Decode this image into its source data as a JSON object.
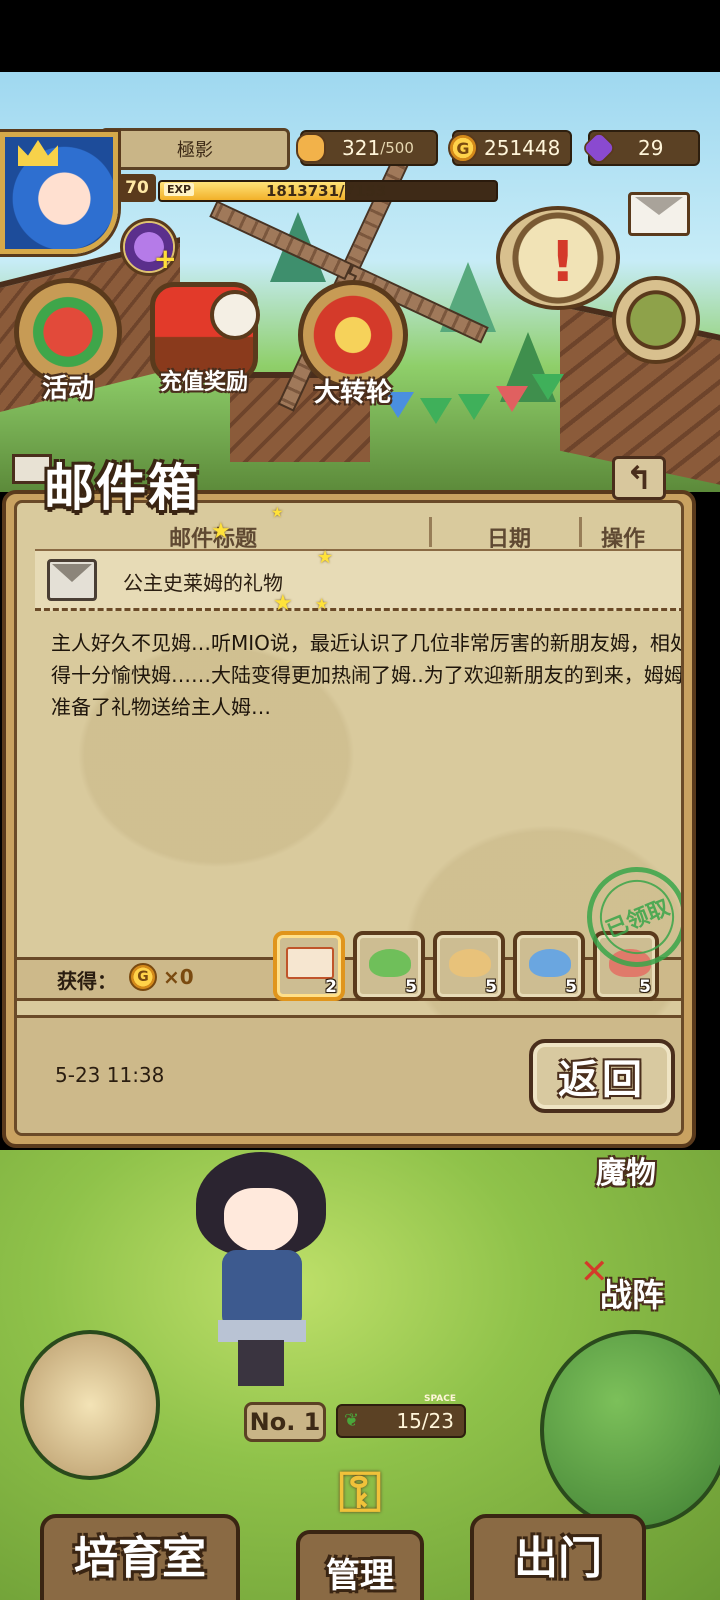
{
  "header": {
    "player_name": "極影",
    "level": "70",
    "exp_label": "EXP",
    "exp_value": "1813731/7153",
    "exp_fill_fraction": 0.55
  },
  "resources": {
    "bread": {
      "value": "321",
      "max": "/500",
      "icon": "bread-icon"
    },
    "gold": {
      "value": "251448",
      "icon": "gold-coin-icon",
      "symbol": "G"
    },
    "gem": {
      "value": "29",
      "icon": "purple-gem-icon"
    }
  },
  "top_buttons": {
    "activity": "活动",
    "recharge_reward": "充值奖励",
    "big_wheel": "大转轮",
    "scroll_alert": "!"
  },
  "mailbox": {
    "title": "邮件箱",
    "columns": [
      "邮件标题",
      "日期",
      "操作"
    ],
    "subject": "公主史莱姆的礼物",
    "body": "主人好久不见姆…听MIO说，最近认识了几位非常厉害的新朋友姆，相处得十分愉快姆……大陆变得更加热闹了姆..为了欢迎新朋友的到来，姆姆准备了礼物送给主人姆…",
    "got_label": "获得：",
    "gold_symbol": "G",
    "gold_amount": "×0",
    "items": [
      {
        "icon": "ticket-icon",
        "qty": "2",
        "color": "#f6e6d0"
      },
      {
        "icon": "green-slime-icon",
        "qty": "5",
        "color": "#6fbf5a"
      },
      {
        "icon": "yellow-slime-icon",
        "qty": "5",
        "color": "#e8c27a"
      },
      {
        "icon": "blue-slime-icon",
        "qty": "5",
        "color": "#6aa6e0"
      },
      {
        "icon": "red-slime-icon",
        "qty": "5",
        "color": "#e07a6a"
      }
    ],
    "claimed_stamp": "已领取",
    "date": "5-23 11:38",
    "return_label": "返回"
  },
  "scene": {
    "monster_label": "魔物",
    "formation_label": "战阵",
    "no_label": "No. 1",
    "space_label": "SPACE",
    "space_count": "15/23"
  },
  "bottom_nav": {
    "nursery": "培育室",
    "manage": "管理",
    "sortie": "出门"
  },
  "colors": {
    "panel": "#c9a261",
    "paper": "#d9ca9d",
    "frame": "#5a3a1c",
    "stamp": "#3aa64a"
  }
}
